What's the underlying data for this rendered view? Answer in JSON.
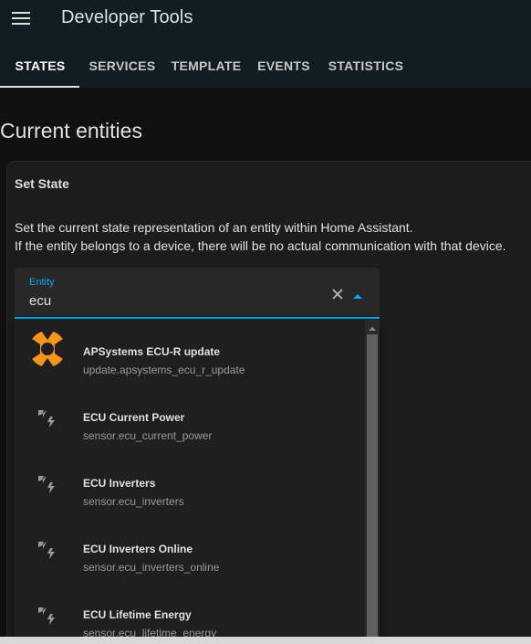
{
  "header": {
    "title": "Developer Tools",
    "menu_icon": "hamburger-menu-icon"
  },
  "tabs": [
    {
      "label": "STATES",
      "active": true
    },
    {
      "label": "SERVICES",
      "active": false
    },
    {
      "label": "TEMPLATE",
      "active": false
    },
    {
      "label": "EVENTS",
      "active": false
    },
    {
      "label": "STATISTICS",
      "active": false
    }
  ],
  "page": {
    "title": "Current entities"
  },
  "card": {
    "title": "Set State",
    "description_line1": "Set the current state representation of an entity within Home Assistant.",
    "description_line2": "If the entity belongs to a device, there will be no actual communication with that device."
  },
  "entity_picker": {
    "label": "Entity",
    "value": "ecu",
    "clear_icon": "close-icon",
    "toggle_icon": "caret-up-icon"
  },
  "options": [
    {
      "name": "APSystems ECU-R update",
      "entity_id": "update.apsystems_ecu_r_update",
      "icon": "apsystems-logo-icon"
    },
    {
      "name": "ECU Current Power",
      "entity_id": "sensor.ecu_current_power",
      "icon": "flash-icon"
    },
    {
      "name": "ECU Inverters",
      "entity_id": "sensor.ecu_inverters",
      "icon": "flash-icon"
    },
    {
      "name": "ECU Inverters Online",
      "entity_id": "sensor.ecu_inverters_online",
      "icon": "flash-icon"
    },
    {
      "name": "ECU Lifetime Energy",
      "entity_id": "sensor.ecu_lifetime_energy",
      "icon": "flash-icon"
    }
  ],
  "colors": {
    "accent": "#03a9f4",
    "header_bg": "#101e24",
    "logo_orange": "#f7941d"
  }
}
